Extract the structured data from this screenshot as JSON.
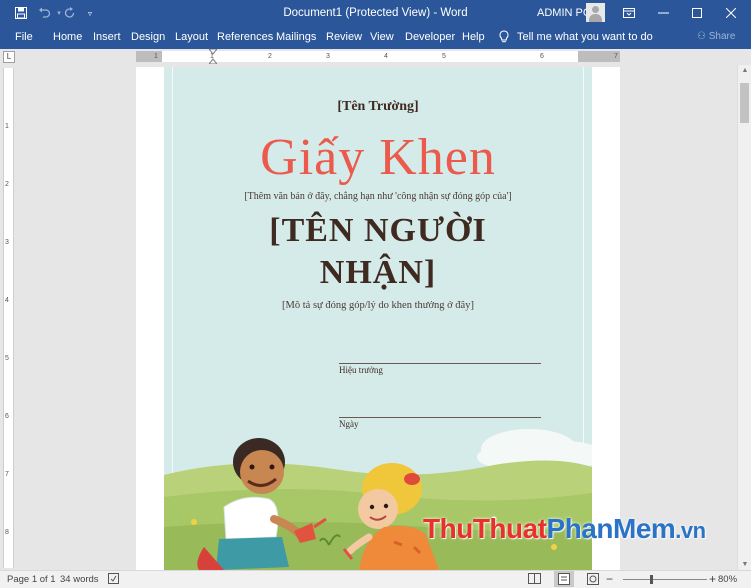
{
  "titlebar": {
    "document_title": "Document1 (Protected View) - Word",
    "user_name": "ADMIN PC"
  },
  "ribbon": {
    "tabs": [
      "File",
      "Home",
      "Insert",
      "Design",
      "Layout",
      "References",
      "Mailings",
      "Review",
      "View",
      "Developer",
      "Help"
    ],
    "tell_me": "Tell me what you want to do",
    "share": "Share"
  },
  "ruler": {
    "h_numbers": [
      "1",
      "1",
      "2",
      "3",
      "4",
      "5",
      "6",
      "7"
    ],
    "v_numbers": [
      "1",
      "2",
      "3",
      "4",
      "5",
      "6",
      "7",
      "8"
    ]
  },
  "certificate": {
    "school": "[Tên Trường]",
    "headline": "Giấy Khen",
    "subtitle": "[Thêm văn bản ở đây, chẳng hạn như 'công nhận sự đóng góp của']",
    "recipient_line1": "[TÊN NGƯỜI",
    "recipient_line2": "NHẬN]",
    "description": "[Mô tả sự đóng góp/lý do khen thưởng ở đây]",
    "signature_label": "Hiệu trưởng",
    "date_label": "Ngày"
  },
  "watermark": {
    "part1": "Thu",
    "part2": "Thuat",
    "part3": "Phan",
    "part4": "Mem",
    "part5": ".vn"
  },
  "statusbar": {
    "page": "Page 1 of 1",
    "words": "34 words",
    "zoom": "80%",
    "zoom_level": 0.8
  },
  "colors": {
    "ribbon": "#2b579a",
    "headline": "#ea5a4d",
    "certificate_bg": "#d5ebe9"
  }
}
